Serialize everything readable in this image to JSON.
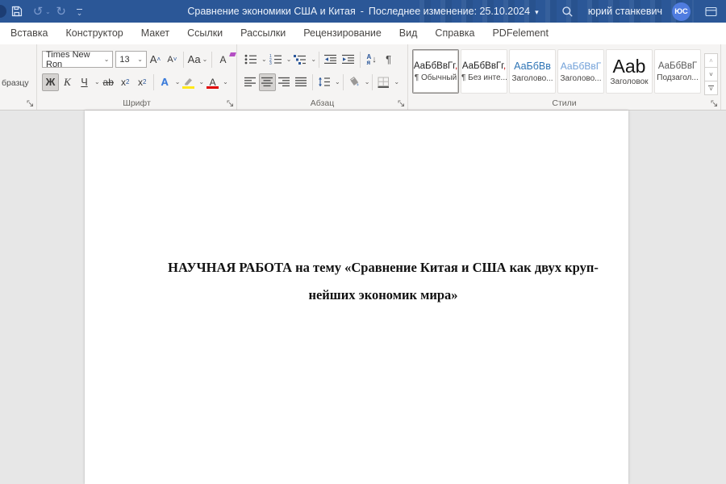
{
  "titlebar": {
    "doc_title": "Сравнение экономики США и Китая",
    "separator": "-",
    "last_modified": "Последнее изменение: 25.10.2024",
    "user_name": "юрий станкевич",
    "avatar_initials": "ЮС"
  },
  "tabs": [
    "Вставка",
    "Конструктор",
    "Макет",
    "Ссылки",
    "Рассылки",
    "Рецензирование",
    "Вид",
    "Справка",
    "PDFelement"
  ],
  "ribbon": {
    "clipboard": {
      "visible_label": "бразцу"
    },
    "font": {
      "group_label": "Шрифт",
      "font_name": "Times New Ron",
      "font_size": "13",
      "grow": "А",
      "shrink": "А",
      "change_case": "Аа",
      "clear": "А",
      "bold": "Ж",
      "italic": "К",
      "underline": "Ч",
      "strikethrough": "ab",
      "sub_base": "x",
      "sub_script": "2",
      "sup_base": "x",
      "sup_script": "2",
      "text_effects": "А",
      "font_color": "А"
    },
    "paragraph": {
      "group_label": "Абзац",
      "sort_top": "А",
      "sort_bottom": "я",
      "pilcrow": "¶"
    },
    "styles": {
      "group_label": "Стили",
      "items": [
        {
          "preview": "АаБбВвГг",
          "suffix": ",",
          "label": "¶ Обычный"
        },
        {
          "preview": "АаБбВвГг",
          "suffix": ",",
          "label": "¶ Без инте..."
        },
        {
          "preview": "АаБбВв",
          "suffix": "",
          "label": "Заголово..."
        },
        {
          "preview": "АаБбВвГ",
          "suffix": "",
          "label": "Заголово..."
        },
        {
          "preview": "Аab",
          "suffix": "",
          "label": "Заголовок"
        },
        {
          "preview": "АаБбВвГ",
          "suffix": "",
          "label": "Подзагол..."
        }
      ]
    }
  },
  "document": {
    "line1": "НАУЧНАЯ РАБОТА на тему «Сравнение Китая и США как двух круп-",
    "line2": "нейших экономик мира»"
  },
  "colors": {
    "titlebar_blue": "#2b5797",
    "avatar_blue": "#4f7ce0",
    "accent_blue": "#2b579a",
    "highlight_yellow": "#ffe81a",
    "font_color_red": "#e00000",
    "heading1_blue": "#2e74b5",
    "heading2_blue": "#6f9fd8"
  }
}
